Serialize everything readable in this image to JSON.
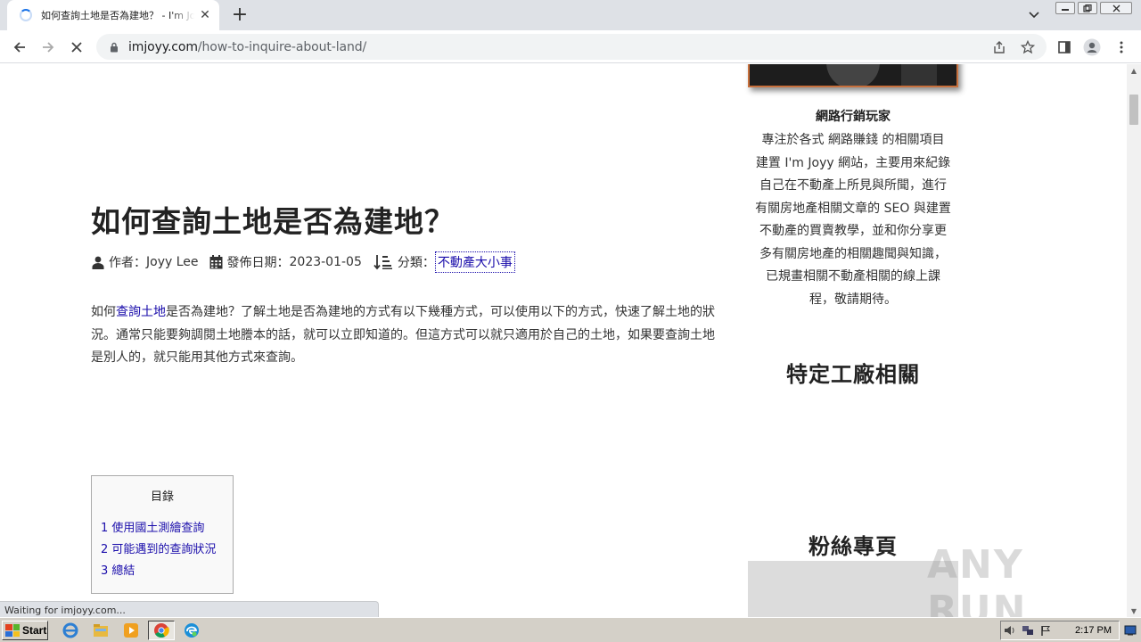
{
  "browser": {
    "tab_title": "如何查詢土地是否為建地？ - I'm Joyy",
    "new_tab_symbol": "+",
    "url_domain": "imjoyy.com",
    "url_path": "/how-to-inquire-about-land/",
    "status_text": "Waiting for imjoyy.com..."
  },
  "article": {
    "title": "如何查詢土地是否為建地？",
    "meta": {
      "author_label": "作者：",
      "author": "Joyy Lee",
      "date_label": "發佈日期：",
      "date": "2023-01-05",
      "category_label": "分類：",
      "category": "不動產大小事"
    },
    "intro": {
      "pre": "如何",
      "link": "查詢土地",
      "post": "是否為建地？了解土地是否為建地的方式有以下幾種方式，可以使用以下的方式，快速了解土地的狀況。通常只能要夠調閱土地謄本的話，就可以立即知道的。但這方式可以就只適用於自己的土地，如果要查詢土地是別人的，就只能用其他方式來查詢。"
    },
    "toc": {
      "title": "目錄",
      "items": [
        "1 使用國土測繪查詢",
        "2 可能遇到的查詢狀況",
        "3 總結"
      ]
    }
  },
  "sidebar": {
    "author_name": "網路行銷玩家",
    "bio_lines": [
      "專注於各式 網路賺錢 的相關項目",
      "建置 I'm Joyy 網站，主要用來紀錄",
      "自己在不動產上所見與所聞，進行",
      "有關房地產相關文章的 SEO 與建置",
      "不動產的買賣教學，並和你分享更",
      "多有關房地產的相關趣聞與知識，",
      "已規畫相關不動產相關的線上課",
      "程，敬請期待。"
    ],
    "widget1_title": "特定工廠相關",
    "widget2_title": "粉絲專頁"
  },
  "watermark": "ANY RUN",
  "taskbar": {
    "start_label": "Start",
    "clock": "2:17 PM"
  },
  "colors": {
    "link": "#1a0dab",
    "accent": "#1a73e8",
    "photo_border": "#c7703d"
  }
}
